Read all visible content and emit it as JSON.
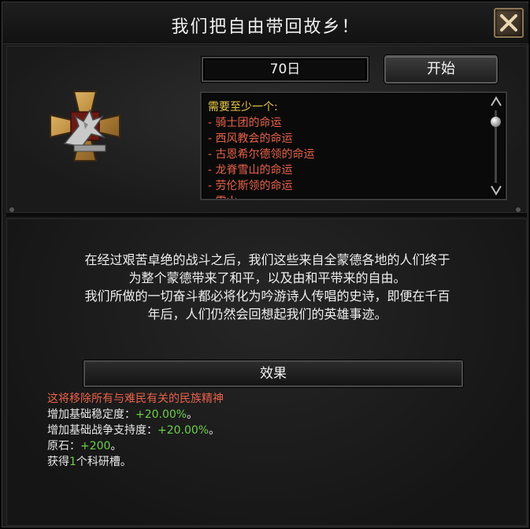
{
  "dialog": {
    "title": "我们把自由带回故乡！"
  },
  "duration": {
    "value": "70日"
  },
  "start_button": {
    "label": "开始"
  },
  "requirements": {
    "heading": "需要至少一个:",
    "items": [
      "- 骑士团的命运",
      "- 西风教会的命运",
      "- 古恩希尔德领的命运",
      "- 龙脊雪山的命运",
      "- 劳伦斯领的命运",
      "- 雪山..."
    ]
  },
  "description": {
    "line1": "在经过艰苦卓绝的战斗之后，我们这些来自全蒙德各地的人们终于",
    "line2": "为整个蒙德带来了和平，以及由和平带来的自由。",
    "line3": "我们所做的一切奋斗都必将化为吟游诗人传唱的史诗，即便在千百",
    "line4": "年后，人们仍然会回想起我们的英雄事迹。"
  },
  "effects": {
    "header": "效果",
    "remove_spirit": "这将移除所有与难民有关的民族精神",
    "stability_label": "增加基础稳定度：",
    "stability_value": "+20.00%",
    "war_support_label": "增加基础战争支持度：",
    "war_support_value": "+20.00%",
    "stone_label": "原石：",
    "stone_value": "+200",
    "research_prefix": "获得",
    "research_count": "1",
    "research_suffix": "个科研槽。",
    "end_mark": "。"
  },
  "icons": {
    "close": "close-icon",
    "emblem": "eagle-cross-emblem-icon",
    "scroll_up": "scroll-up-arrow-icon",
    "scroll_down": "scroll-down-arrow-icon"
  },
  "colors": {
    "requirement_heading": "#e8c84a",
    "requirement_item": "#e8624a",
    "positive_value": "#6ccf4a",
    "warning_text": "#e8624a"
  }
}
